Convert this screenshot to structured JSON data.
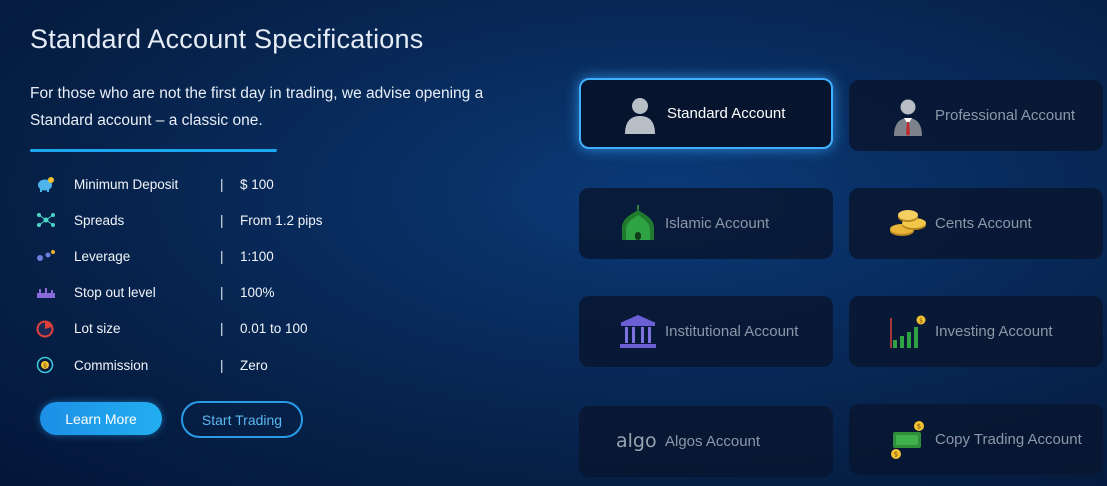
{
  "header": {
    "title": "Standard Account Specifications",
    "intro": "For those who are not the first day in trading, we advise opening a Standard account – a classic one."
  },
  "specs": [
    {
      "icon": "piggy-bank-icon",
      "label": "Minimum Deposit",
      "sep": "|",
      "value": "$ 100"
    },
    {
      "icon": "spreads-icon",
      "label": "Spreads",
      "sep": "|",
      "value": "From 1.2 pips"
    },
    {
      "icon": "leverage-icon",
      "label": "Leverage",
      "sep": "|",
      "value": "1:100"
    },
    {
      "icon": "stop-out-icon",
      "label": "Stop out level",
      "sep": "|",
      "value": "100%"
    },
    {
      "icon": "lot-size-icon",
      "label": "Lot size",
      "sep": "|",
      "value": "0.01 to 100"
    },
    {
      "icon": "commission-icon",
      "label": "Commission",
      "sep": "|",
      "value": "Zero"
    }
  ],
  "buttons": {
    "learn_more": "Learn More",
    "start_trading": "Start Trading"
  },
  "accounts": [
    {
      "label": "Standard Account",
      "icon": "user-silhouette-icon",
      "active": true
    },
    {
      "label": "Professional Account",
      "icon": "businessman-icon",
      "active": false
    },
    {
      "label": "Islamic Account",
      "icon": "mosque-icon",
      "active": false
    },
    {
      "label": "Cents Account",
      "icon": "coins-icon",
      "active": false
    },
    {
      "label": "Institutional Account",
      "icon": "institution-icon",
      "active": false
    },
    {
      "label": "Investing Account",
      "icon": "growth-chart-icon",
      "active": false
    },
    {
      "label": "Algos Account",
      "icon": "algo-logo-icon",
      "icon_text": "algo",
      "active": false
    },
    {
      "label": "Copy Trading Account",
      "icon": "copy-trading-icon",
      "active": false
    }
  ],
  "colors": {
    "accent": "#1aa7f0",
    "active_border": "#3fb0ff",
    "inactive_text": "#8c97a8"
  }
}
